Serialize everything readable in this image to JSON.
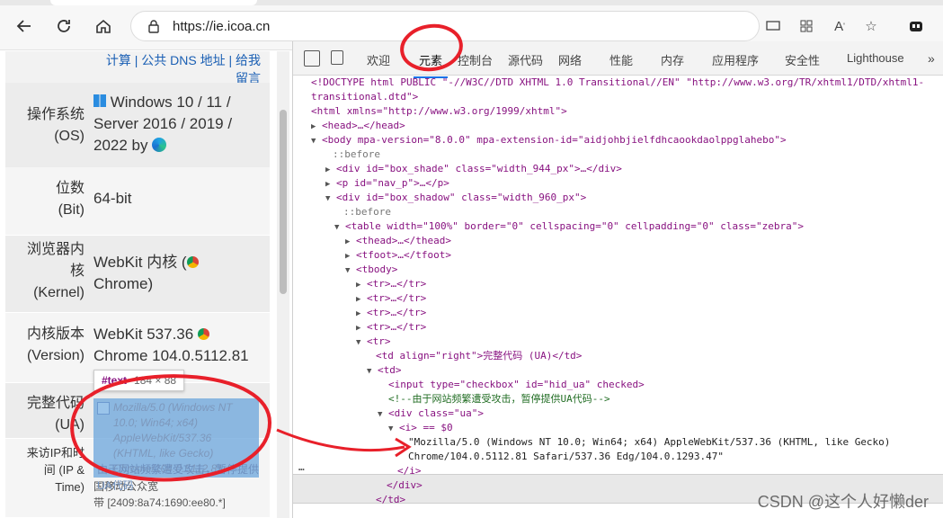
{
  "browser": {
    "url": "https://ie.icoa.cn",
    "icons": [
      "back-icon",
      "refresh-icon",
      "home-icon",
      "lock-icon",
      "cast-icon",
      "grid-icon",
      "read-aloud-icon",
      "favorite-icon",
      "extension-icon"
    ]
  },
  "page": {
    "top_links": "计算 | 公共 DNS 地址 | 给我留言",
    "rows": [
      {
        "label": "操作系统\n(OS)",
        "value": "Windows 10 / 11 / Server 2016 / 2019 / 2022 by"
      },
      {
        "label": "位数\n(Bit)",
        "value": "64-bit"
      },
      {
        "label": "浏览器内核\n(Kernel)",
        "value": "WebKit 内核 (\nChrome)"
      },
      {
        "label": "内核版本\n(Version)",
        "value": "WebKit 537.36\nChrome 104.0.5112.81"
      },
      {
        "label": "完整代码\n(UA)",
        "value": ""
      },
      {
        "label": "来访IP和时间 (IP &\nTime)",
        "value": "国移动公众宽\n带 [2409:8a74:1690:ee80.*]"
      }
    ],
    "tooltip": {
      "tag": "#text",
      "dims": "184 × 88"
    },
    "ua_text": "Mozilla/5.0 (Windows NT 10.0; Win64; x64) AppleWebKit/537.36 (KHTML, like Gecko) Chrome/104.0.5112.81",
    "ua_overlay": "由于网站频繁遭受攻击，暂停提供UA代码"
  },
  "devtools": {
    "tabs": [
      "欢迎",
      "元素",
      "控制台",
      "源代码",
      "网络",
      "性能",
      "内存",
      "应用程序",
      "安全性",
      "Lighthouse"
    ],
    "active_tab": "元素",
    "lines": {
      "l1": "<!DOCTYPE html PUBLIC \"-//W3C//DTD XHTML 1.0 Transitional//EN\" \"http://www.w3.org/TR/xhtml1/DTD/xhtml1-",
      "l2": "transitional.dtd\">",
      "l3": "<html xmlns=\"http://www.w3.org/1999/xhtml\">",
      "l4": "<head>…</head>",
      "l5": "<body mpa-version=\"8.0.0\" mpa-extension-id=\"aidjohbjielfdhcaookdaolppglahebo\">",
      "l6": "::before",
      "l7": "<div id=\"box_shade\" class=\"width_944_px\">…</div>",
      "l8": "<p id=\"nav_p\">…</p>",
      "l9": "<div id=\"box_shadow\" class=\"width_960_px\">",
      "l10": "::before",
      "l11": "<table width=\"100%\" border=\"0\" cellspacing=\"0\" cellpadding=\"0\" class=\"zebra\">",
      "l12": "<thead>…</thead>",
      "l13": "<tfoot>…</tfoot>",
      "l14": "<tbody>",
      "l15": "<tr>…</tr>",
      "l16": "<tr>…</tr>",
      "l17": "<tr>…</tr>",
      "l18": "<tr>…</tr>",
      "l19": "<tr>",
      "l20": "<td align=\"right\">完整代码 (UA)</td>",
      "l21": "<td>",
      "l22": "<input type=\"checkbox\" id=\"hid_ua\" checked>",
      "l23": "<!--由于网站频繁遭受攻击，暂停提供UA代码-->",
      "l24": "<div class=\"ua\">",
      "l25": "<i> == $0",
      "l26": "\"Mozilla/5.0 (Windows NT 10.0; Win64; x64) AppleWebKit/537.36 (KHTML, like Gecko)",
      "l27": "Chrome/104.0.5112.81 Safari/537.36 Edg/104.0.1293.47\"",
      "l28": "</i>",
      "l29": "</div>",
      "l30": "</td>"
    }
  },
  "watermark": "CSDN @这个人好懒der"
}
